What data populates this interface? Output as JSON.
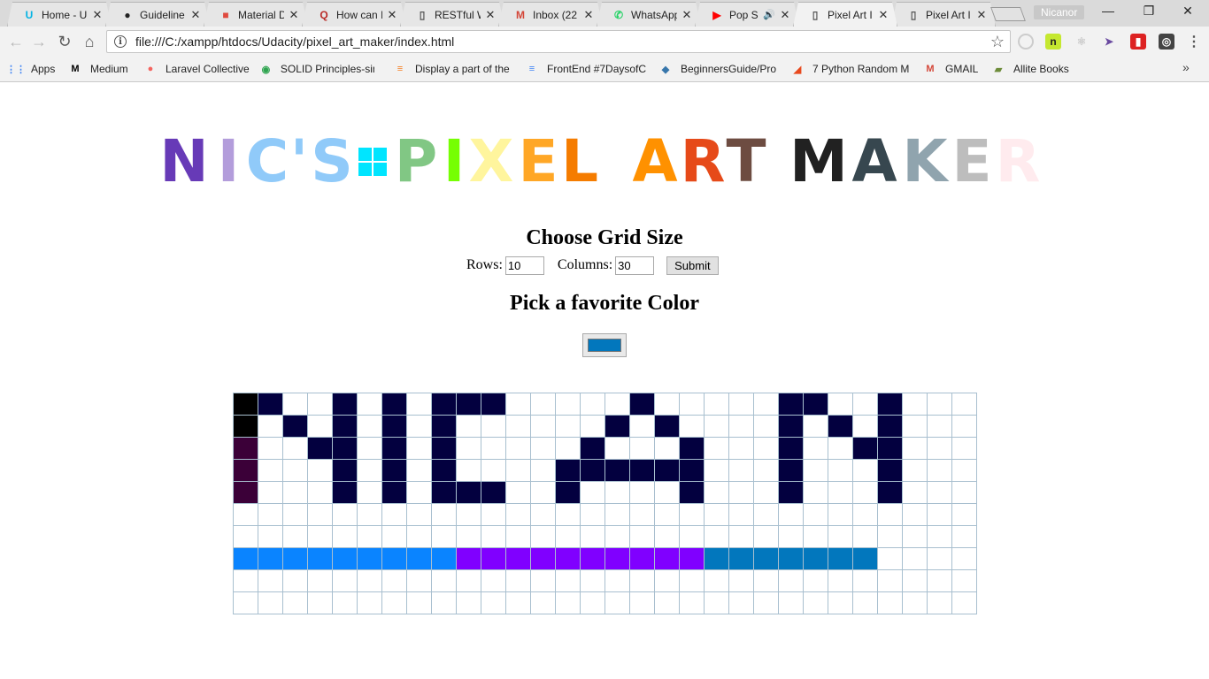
{
  "browser": {
    "tabs": [
      {
        "title": "Home - U",
        "icon": "udacity-icon",
        "icon_glyph": "U",
        "icon_color": "#02b3e4",
        "active": false
      },
      {
        "title": "Guideline",
        "icon": "github-icon",
        "icon_glyph": "●",
        "icon_color": "#222222",
        "active": false
      },
      {
        "title": "Material D",
        "icon": "material-icon",
        "icon_glyph": "■",
        "icon_color": "#e04a3f",
        "active": false
      },
      {
        "title": "How can I",
        "icon": "quora-icon",
        "icon_glyph": "Q",
        "icon_color": "#b92b27",
        "active": false
      },
      {
        "title": "RESTful W",
        "icon": "page-icon",
        "icon_glyph": "▯",
        "icon_color": "#555555",
        "active": false
      },
      {
        "title": "Inbox (22",
        "icon": "gmail-icon",
        "icon_glyph": "M",
        "icon_color": "#d44638",
        "active": false
      },
      {
        "title": "WhatsApp",
        "icon": "whatsapp-icon",
        "icon_glyph": "✆",
        "icon_color": "#25d366",
        "active": false
      },
      {
        "title": "Pop S",
        "icon": "youtube-icon",
        "icon_glyph": "▶",
        "icon_color": "#ff0000",
        "active": false,
        "audio": true
      },
      {
        "title": "Pixel Art I",
        "icon": "page-icon",
        "icon_glyph": "▯",
        "icon_color": "#555555",
        "active": true
      },
      {
        "title": "Pixel Art I",
        "icon": "page-icon",
        "icon_glyph": "▯",
        "icon_color": "#555555",
        "active": false
      }
    ],
    "profile_name": "Nicanor",
    "url": "file:///C:/xampp/htdocs/Udacity/pixel_art_maker/index.html",
    "bookmarks": [
      {
        "label": "Apps",
        "icon": "apps-grid-icon",
        "glyph": "⋮⋮",
        "color": "#4285f4"
      },
      {
        "label": "Medium",
        "icon": "medium-icon",
        "glyph": "M",
        "color": "#000000"
      },
      {
        "label": "Laravel Collective",
        "icon": "laravel-icon",
        "glyph": "●",
        "color": "#f4645f"
      },
      {
        "label": "SOLID Principles-sim",
        "icon": "solid-icon",
        "glyph": "◉",
        "color": "#2ea44f"
      },
      {
        "label": "Display a part of the",
        "icon": "stackoverflow-icon",
        "glyph": "≡",
        "color": "#f48024"
      },
      {
        "label": "FrontEnd #7DaysofC",
        "icon": "docs-icon",
        "glyph": "≡",
        "color": "#4285f4"
      },
      {
        "label": "BeginnersGuide/Pro",
        "icon": "python-icon",
        "glyph": "◆",
        "color": "#3776ab"
      },
      {
        "label": "7 Python Random M",
        "icon": "codementor-icon",
        "glyph": "◢",
        "color": "#e8491d"
      },
      {
        "label": "GMAIL",
        "icon": "gmail-icon",
        "glyph": "M",
        "color": "#d44638"
      },
      {
        "label": "Allite Books",
        "icon": "books-icon",
        "glyph": "▰",
        "color": "#6d8c3a"
      }
    ]
  },
  "page": {
    "logo_text": "Nic's:Pixel Art Maker",
    "heading_grid": "Choose Grid Size",
    "rows_label": "Rows:",
    "rows_value": "10",
    "columns_label": "Columns:",
    "columns_value": "30",
    "submit_label": "Submit",
    "heading_color": "Pick a favorite Color",
    "selected_color": "#0277bd",
    "grid": {
      "rows": 10,
      "columns": 30,
      "palette": {
        "K": "#000000",
        "P": "#3b0038",
        "N": "#03003f",
        "B": "#0a84ff",
        "V": "#8000ff",
        "C": "#0277bd"
      },
      "cells": [
        "KN..N.N.NNN.....N.....NN..N...",
        "K.N.N.N.N......N.N....N.N.N...",
        "P..NN.N.N.....N...N...N..NN...",
        "P...N.N.N....NNNNNN...N...N...",
        "P...N.N.NNN..N....N...N...N...",
        "..............................",
        "..............................",
        "BBBBBBBBBVVVVVVVVVVCCCCCCC....",
        "..............................",
        ".............................."
      ]
    }
  }
}
